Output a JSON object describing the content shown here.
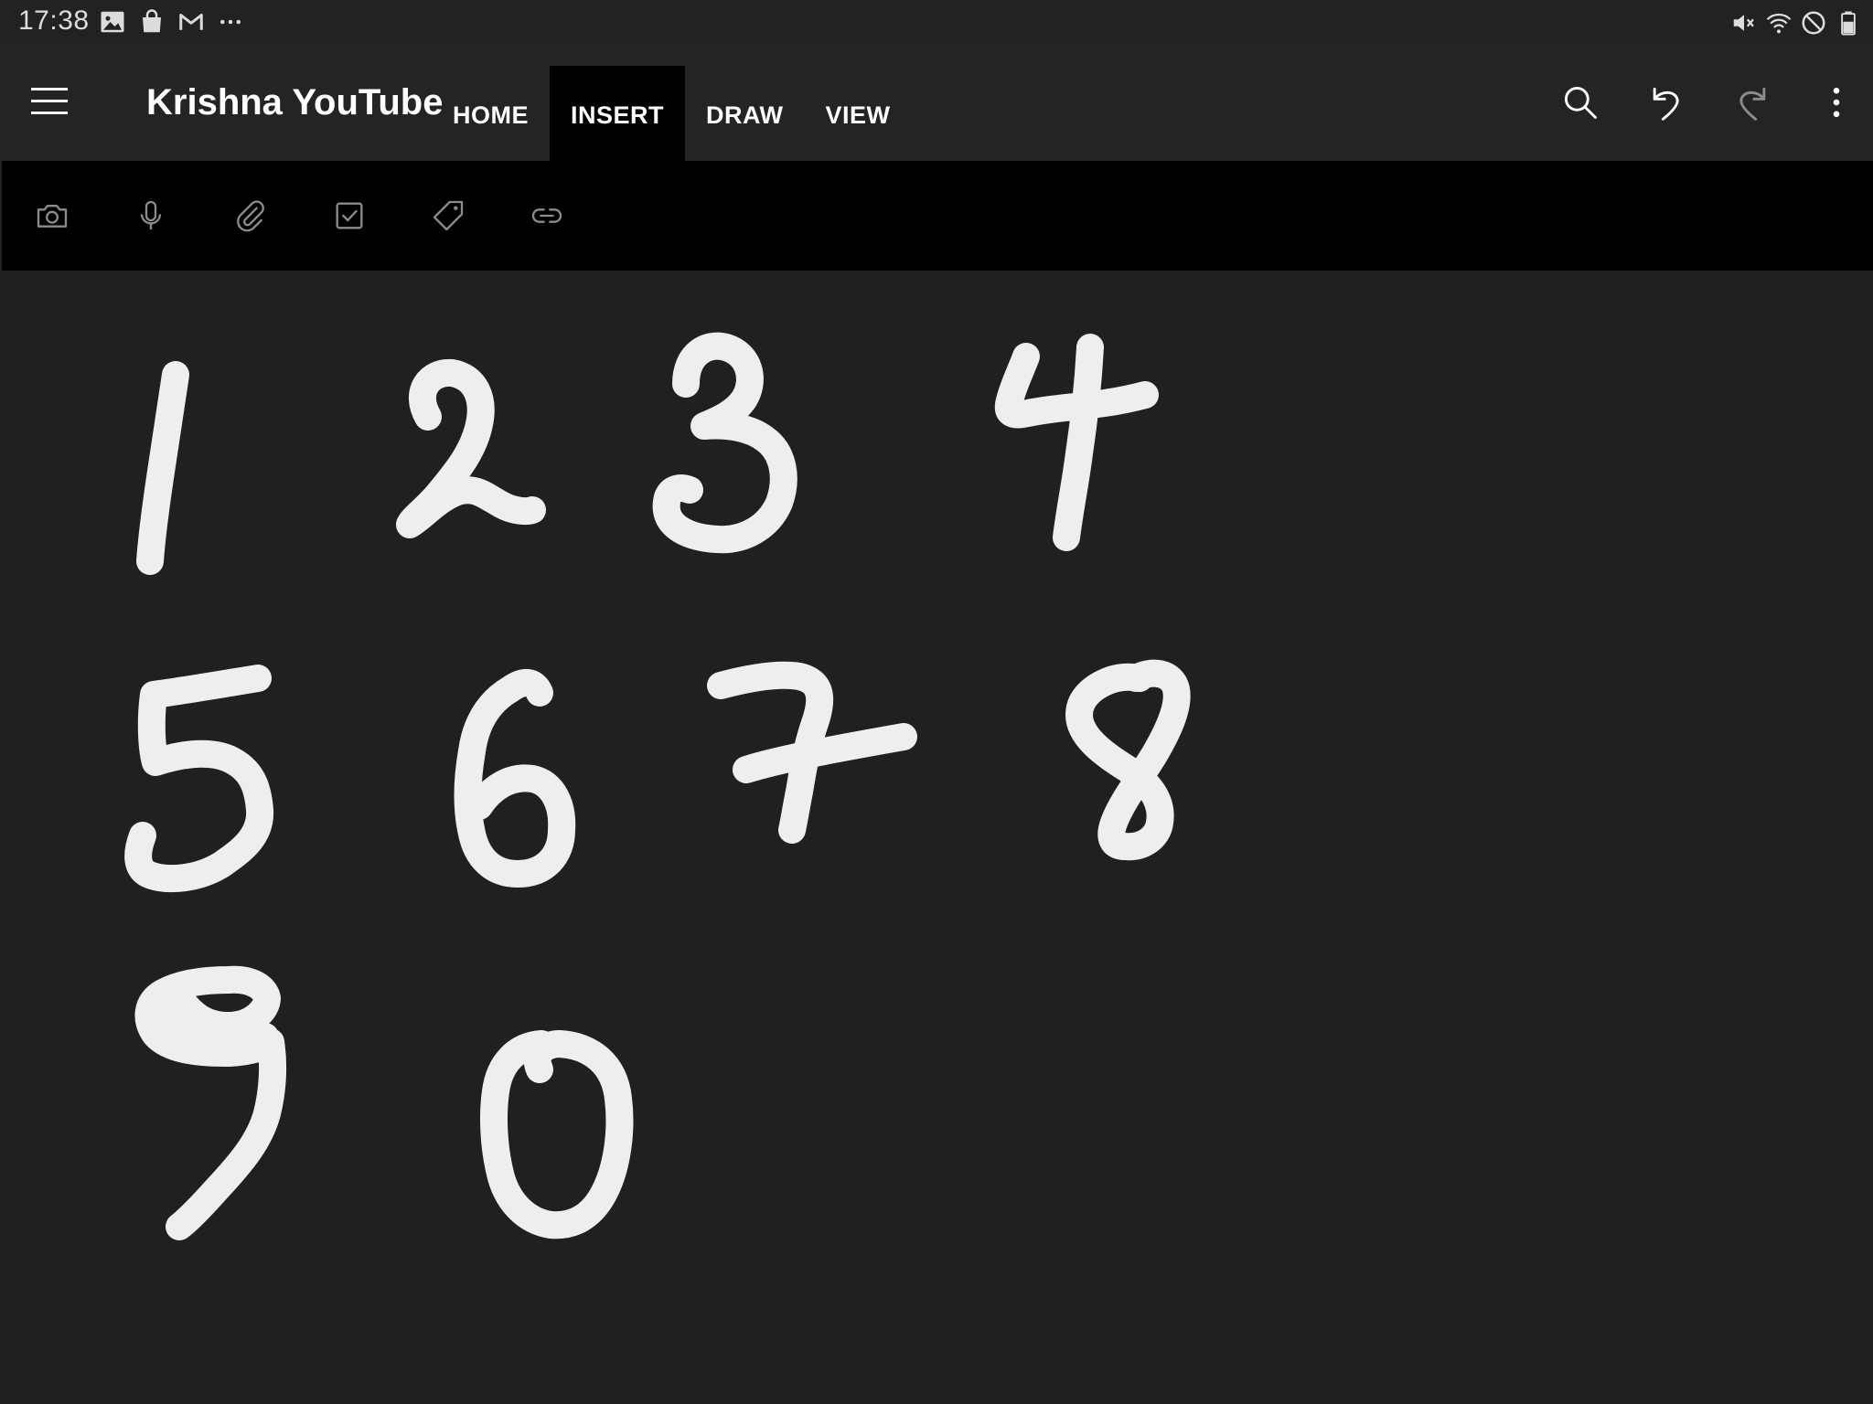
{
  "status_bar": {
    "time": "17:38",
    "left_icons": [
      "gallery-icon",
      "shopping-bag-icon",
      "gmail-icon",
      "more-dots-icon"
    ],
    "right_icons": [
      "mute-icon",
      "wifi-icon",
      "do-not-disturb-icon",
      "battery-icon"
    ]
  },
  "app_bar": {
    "notebook_title": "Krishna YouTube",
    "tabs": [
      {
        "label": "HOME",
        "active": false
      },
      {
        "label": "INSERT",
        "active": true
      },
      {
        "label": "DRAW",
        "active": false
      },
      {
        "label": "VIEW",
        "active": false
      }
    ],
    "actions": [
      "search-icon",
      "undo-icon",
      "redo-icon",
      "more-options-icon"
    ],
    "redo_enabled": false
  },
  "ribbon": {
    "items": [
      "camera-icon",
      "microphone-icon",
      "attachment-icon",
      "checkbox-icon",
      "tag-icon",
      "link-icon"
    ]
  },
  "canvas": {
    "handwritten_digits": [
      "1",
      "2",
      "3",
      "4",
      "5",
      "6",
      "7",
      "8",
      "9",
      "0"
    ]
  },
  "colors": {
    "background": "#202020",
    "app_bar": "#242424",
    "ribbon": "#000000",
    "active_tab": "#000000",
    "ink": "#eeeeec",
    "icon_muted": "#8c8c8c"
  }
}
